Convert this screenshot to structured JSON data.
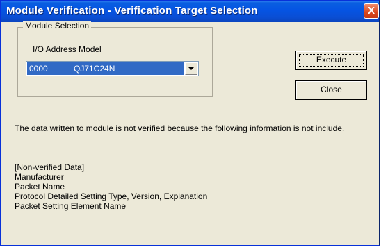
{
  "window": {
    "title": "Module Verification - Verification Target Selection",
    "close_glyph": "X"
  },
  "module_selection": {
    "group_label": "Module Selection",
    "field_label": "I/O Address Model",
    "combo": {
      "io_address": "0000",
      "model": "QJ71C24N"
    }
  },
  "buttons": {
    "execute_label": "Execute",
    "close_label": "Close"
  },
  "message": "The data written to module is not verified because the following information is not include.",
  "non_verified": [
    "[Non-verified Data]",
    "Manufacturer",
    "Packet Name",
    "Protocol Detailed Setting Type, Version, Explanation",
    "Packet Setting Element Name"
  ],
  "colors": {
    "titlebar": "#0554e3",
    "dialog_bg": "#ece9d8",
    "selection": "#316ac5"
  }
}
